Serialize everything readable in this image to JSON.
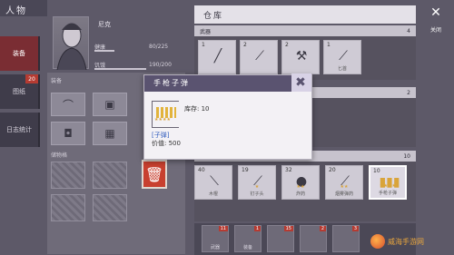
{
  "character": {
    "tab_label": "人物",
    "name": "尼克",
    "hp_label": "健康",
    "hp_value": "80/225",
    "hp_fraction": 0.36,
    "food_label": "饥饿",
    "food_value": "190/200",
    "food_fraction": 0.95,
    "side_tabs": [
      {
        "label": "装备"
      },
      {
        "label": "图纸",
        "badge": "20"
      },
      {
        "label": "日志统计"
      }
    ],
    "equip_label": "装备",
    "backpack_label": "储物格",
    "weapon_icon": "bow-icon"
  },
  "warehouse": {
    "title": "仓库",
    "sections": [
      {
        "label": "武器",
        "page": "4",
        "items": [
          {
            "count": "1",
            "icon": "rifle-icon",
            "name": ""
          },
          {
            "count": "2",
            "icon": "knife-icon",
            "name": ""
          },
          {
            "count": "2",
            "icon": "hammer-icon",
            "name": ""
          },
          {
            "count": "1",
            "icon": "spear-icon",
            "name": "匕首"
          }
        ]
      },
      {
        "label": "",
        "page": "2",
        "items": []
      },
      {
        "label": "材料",
        "page": "10",
        "items": [
          {
            "count": "40",
            "icon": "stick-icon",
            "name": "木棍",
            "stars": ""
          },
          {
            "count": "19",
            "icon": "mace-icon",
            "name": "钉子头",
            "stars": "★"
          },
          {
            "count": "32",
            "icon": "bomb-icon",
            "name": "炸药",
            "stars": "★★"
          },
          {
            "count": "20",
            "icon": "wand-icon",
            "name": "烟雾弹药",
            "stars": "★★"
          },
          {
            "count": "10",
            "icon": "ammo-icon",
            "name": "手枪子弹",
            "stars": "★★★★"
          }
        ]
      }
    ],
    "bottom": [
      {
        "badge": "11",
        "icon": "weapon-icon",
        "name": "武器"
      },
      {
        "badge": "1",
        "icon": "armor-icon",
        "name": "装备"
      },
      {
        "badge": "15",
        "icon": "tool-icon",
        "name": ""
      },
      {
        "badge": "2",
        "icon": "food-icon",
        "name": ""
      },
      {
        "badge": "3",
        "icon": "misc-icon",
        "name": ""
      }
    ]
  },
  "close_label": "关闭",
  "popup": {
    "title": "手枪子弹",
    "durability_label": "库存",
    "durability_value": "10",
    "desc_tag": "[子弹]",
    "value_label": "价值",
    "value": "500"
  },
  "watermark": {
    "text": "威海手游网"
  },
  "colors": {
    "accent_red": "#c8402f",
    "popup_head": "#5a5370",
    "star": "#d9a43a"
  }
}
